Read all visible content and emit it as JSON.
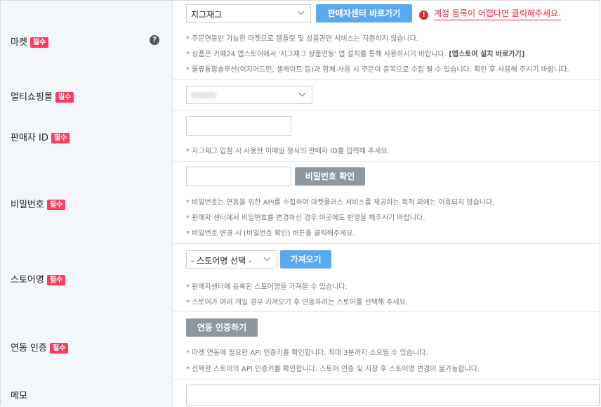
{
  "market": {
    "label": "마켓",
    "required": "필수",
    "help_icon": "?",
    "select_value": "지그재그",
    "seller_center_button": "판매자센터 바로가기",
    "alert_icon": "!",
    "alert_text": "계정 등록이 어렵다면 클릭해주세요.",
    "notes": [
      "* 주문연동만 가능한 마켓으로 템플릿 및 상품관련 서비스는 지원하지 않습니다.",
      "* 상품은 카페24 앱스토어에서 '지그재그 상품연동' 앱 설치를 통해 사용하시기 바랍니다.",
      "* 물류통합솔루션(이지어드민, 셀메이트 등)과 함께 사용 시 주문이 중복으로 수집 될 수 있습니다. 확인 후 사용해 주시기 바랍니다."
    ],
    "appstore_link": "[앱스토어 설치 바로가기]"
  },
  "multi_mall": {
    "label": "멀티쇼핑몰",
    "required": "필수"
  },
  "seller_id": {
    "label": "판매자 ID",
    "required": "필수",
    "note": "* 지그재그 입점 시 사용한 이메일 형식의 판매자 ID를 입력해 주세요."
  },
  "password": {
    "label": "비밀번호",
    "required": "필수",
    "confirm_button": "비밀번호 확인",
    "notes": [
      "* 비밀번호는 연동을 위한 API를 수집하여 마켓플러스 서비스를 제공하는 목적 외에는 이용되지 않습니다.",
      "* 판매자 센터에서 비밀번호를 변경하신 경우 이곳에도 반영을 해주시기 바랍니다.",
      "* 비밀번호 변경 시 [비밀번호 확인] 버튼을 클릭해주세요."
    ]
  },
  "store": {
    "label": "스토어명",
    "required": "필수",
    "select_value": "- 스토어명 선택 -",
    "fetch_button": "가져오기",
    "notes": [
      "* 판매자센터에 등록된 스토어명을 가져올 수 있습니다.",
      "* 스토어가 여러 개일 경우 가져오기 후 연동하려는 스토어를 선택해 주세요."
    ]
  },
  "auth": {
    "label": "연동 인증",
    "required": "필수",
    "auth_button": "연동 인증하기",
    "notes": [
      "* 마켓 연동에 필요한 API 인증키를 확인합니다. 최대 3분까지 소요될 수 있습니다.",
      "* 선택한 스토어의 API 인증키를 확인합니다. 스토어 인증 및 저장 후 스토어명 변경이 불가능합니다."
    ]
  },
  "memo": {
    "label": "메모"
  }
}
